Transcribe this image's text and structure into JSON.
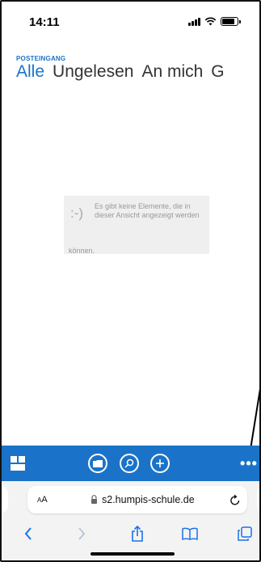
{
  "status_bar": {
    "time": "14:11"
  },
  "mail": {
    "folder_label": "POSTEINGANG",
    "tabs": [
      {
        "label": "Alle",
        "active": true
      },
      {
        "label": "Ungelesen",
        "active": false
      },
      {
        "label": "An mich",
        "active": false
      },
      {
        "label": "G",
        "active": false
      }
    ],
    "empty_state": {
      "face": ":-)",
      "message_main": "Es gibt keine Elemente, die in dieser Ansicht angezeigt werden",
      "message_tail": "können."
    },
    "toolbar": {
      "icons": [
        "grid-icon",
        "folder-icon",
        "search-icon",
        "plus-icon",
        "more-icon"
      ],
      "more_label": "•••"
    }
  },
  "browser": {
    "text_size_label_small": "A",
    "text_size_label_large": "A",
    "url": "s2.humpis-schule.de"
  },
  "colors": {
    "accent": "#1a73c8",
    "empty_bg": "#efefef",
    "safari_bg": "#f3f3f3"
  }
}
